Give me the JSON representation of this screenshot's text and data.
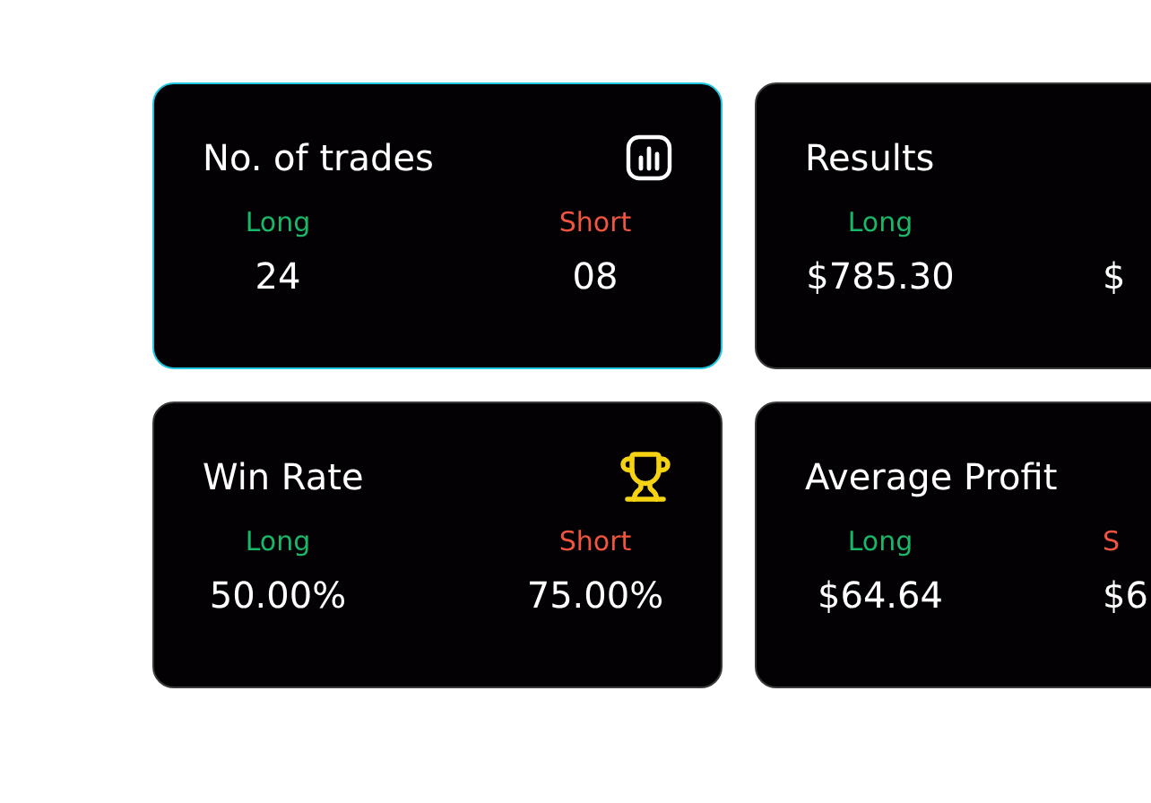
{
  "cards": [
    {
      "kind": "count",
      "title": "No. of trades",
      "selected": true,
      "columns": [
        {
          "kind": "long",
          "label": "Long",
          "value": "24"
        },
        {
          "kind": "short",
          "label": "Short",
          "value": "08"
        }
      ]
    },
    {
      "kind": "amount",
      "title": "Results",
      "selected": false,
      "columns": [
        {
          "kind": "long",
          "label": "Long",
          "value": "$785.30"
        },
        {
          "kind": "short",
          "value": "$"
        }
      ]
    },
    {
      "kind": "rate",
      "title": "Win Rate",
      "selected": false,
      "columns": [
        {
          "kind": "long",
          "label": "Long",
          "value": "50.00%"
        },
        {
          "kind": "short",
          "label": "Short",
          "value": "75.00%"
        }
      ]
    },
    {
      "kind": "average",
      "title": "Average Profit",
      "selected": false,
      "columns": [
        {
          "kind": "long",
          "label": "Long",
          "value": "$64.64"
        },
        {
          "kind": "short",
          "label": "S",
          "value": "$6"
        }
      ]
    }
  ]
}
